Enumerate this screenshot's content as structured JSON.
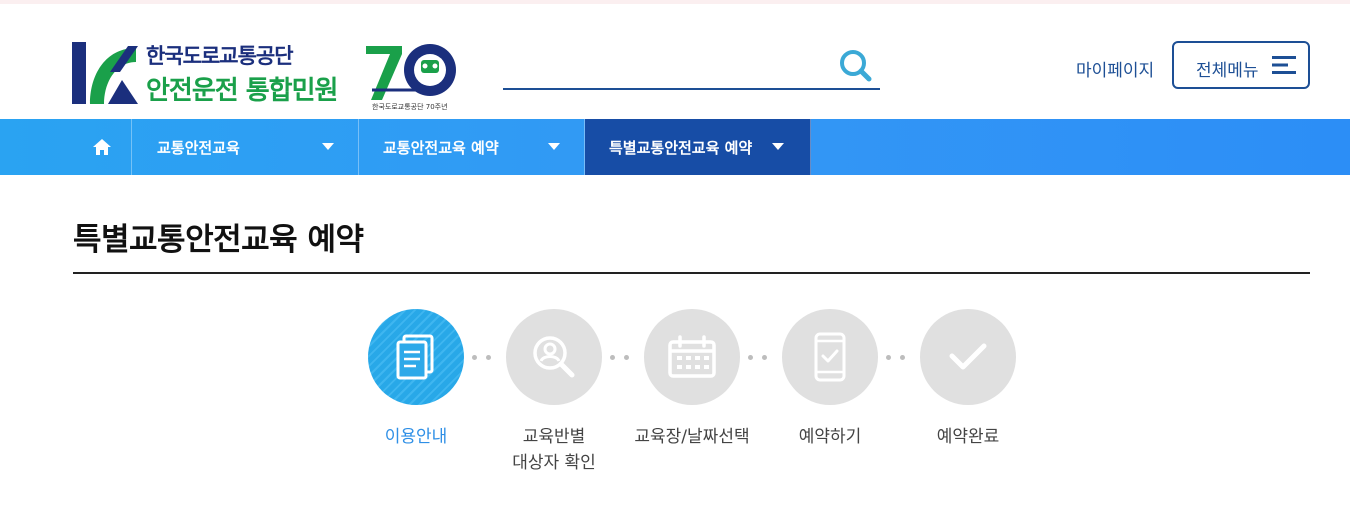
{
  "header": {
    "logo_line1": "한국도로교통공단",
    "logo_line2": "안전운전 통합민원",
    "anniversary_caption": "한국도로교통공단 70주년",
    "search": {
      "value": "",
      "placeholder": ""
    },
    "mypage_label": "마이페이지",
    "allmenu_label": "전체메뉴"
  },
  "gnb": {
    "items": [
      {
        "label": "교통안전교육"
      },
      {
        "label": "교통안전교육 예약"
      },
      {
        "label": "특별교통안전교육 예약"
      }
    ]
  },
  "page": {
    "title": "특별교통안전교육 예약"
  },
  "steps": [
    {
      "line1": "이용안내",
      "line2": "",
      "icon": "document-icon",
      "active": true
    },
    {
      "line1": "교육반별",
      "line2": "대상자 확인",
      "icon": "user-search-icon",
      "active": false
    },
    {
      "line1": "교육장/날짜선택",
      "line2": "",
      "icon": "calendar-icon",
      "active": false
    },
    {
      "line1": "예약하기",
      "line2": "",
      "icon": "mobile-check-icon",
      "active": false
    },
    {
      "line1": "예약완료",
      "line2": "",
      "icon": "checkmark-icon",
      "active": false
    }
  ],
  "colors": {
    "brand_navy": "#1d4f95",
    "gnb_blue": "#3397f5",
    "gnb_active": "#174da6",
    "step_active": "#28a8e8",
    "step_inactive": "#e0e0e0",
    "logo_green": "#1aa04a"
  }
}
